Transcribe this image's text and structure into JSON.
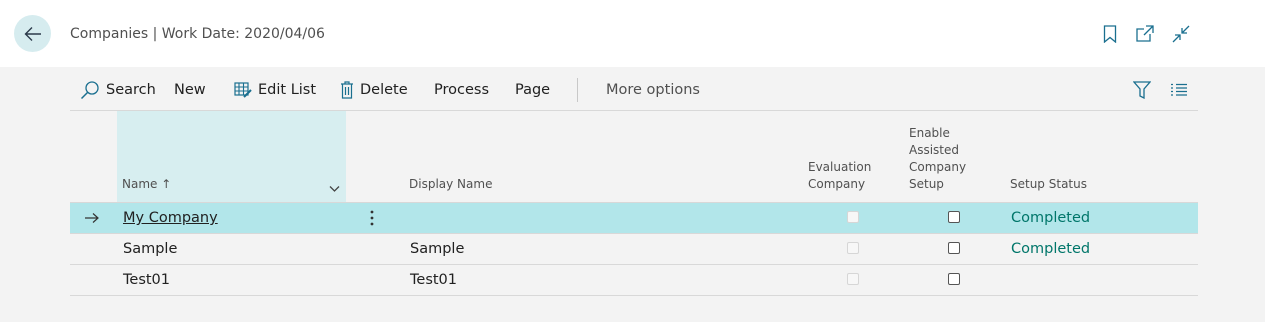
{
  "header": {
    "title": "Companies | Work Date: 2020/04/06",
    "back_icon": "arrow-left-icon",
    "icons": [
      "bookmark-icon",
      "open-new-window-icon",
      "collapse-icon"
    ]
  },
  "actions": {
    "search": "Search",
    "new": "New",
    "edit_list": "Edit List",
    "delete": "Delete",
    "process": "Process",
    "page": "Page",
    "more_options": "More options"
  },
  "columns": {
    "name": "Name",
    "name_sort": "↑",
    "display_name": "Display Name",
    "evaluation_line1": "Evaluation",
    "evaluation_line2": "Company",
    "assisted_line1": "Enable",
    "assisted_line2": "Assisted",
    "assisted_line3": "Company",
    "assisted_line4": "Setup",
    "setup_status": "Setup Status"
  },
  "rows": [
    {
      "name": "My Company",
      "display_name": "",
      "evaluation": false,
      "assisted": false,
      "setup_status": "Completed",
      "selected": true
    },
    {
      "name": "Sample",
      "display_name": "Sample",
      "evaluation": false,
      "assisted": false,
      "setup_status": "Completed",
      "selected": false
    },
    {
      "name": "Test01",
      "display_name": "Test01",
      "evaluation": false,
      "assisted": false,
      "setup_status": "",
      "selected": false
    }
  ],
  "colors": {
    "accent": "#00766a",
    "selected_row": "#b2e6ea",
    "column_highlight": "#d7eef0"
  }
}
